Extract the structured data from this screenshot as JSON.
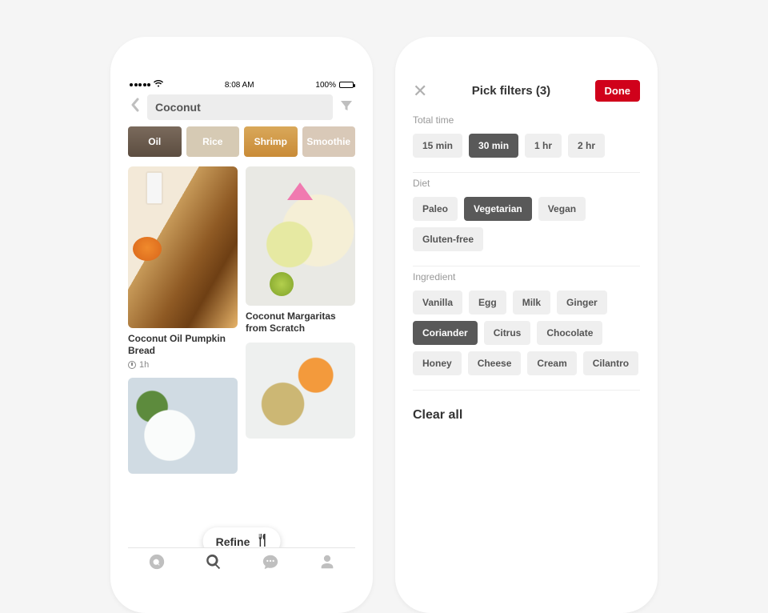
{
  "left": {
    "status": {
      "time": "8:08 AM",
      "battery": "100%"
    },
    "search": {
      "value": "Coconut"
    },
    "tiles": [
      "Oil",
      "Rice",
      "Shrimp",
      "Smoothie"
    ],
    "pins": [
      {
        "title": "Coconut Oil Pumpkin Bread",
        "duration": "1h"
      },
      {
        "title": "Coconut Margaritas from Scratch"
      }
    ],
    "refine": "Refine"
  },
  "right": {
    "title": "Pick filters (3)",
    "done": "Done",
    "sections": {
      "time": {
        "label": "Total time",
        "opts": [
          "15 min",
          "30 min",
          "1 hr",
          "2 hr"
        ],
        "selected": "30 min"
      },
      "diet": {
        "label": "Diet",
        "opts": [
          "Paleo",
          "Vegetarian",
          "Vegan",
          "Gluten-free"
        ],
        "selected": "Vegetarian"
      },
      "ingr": {
        "label": "Ingredient",
        "opts": [
          "Vanilla",
          "Egg",
          "Milk",
          "Ginger",
          "Coriander",
          "Citrus",
          "Chocolate",
          "Honey",
          "Cheese",
          "Cream",
          "Cilantro"
        ],
        "selected": "Coriander"
      }
    },
    "clear": "Clear all"
  }
}
